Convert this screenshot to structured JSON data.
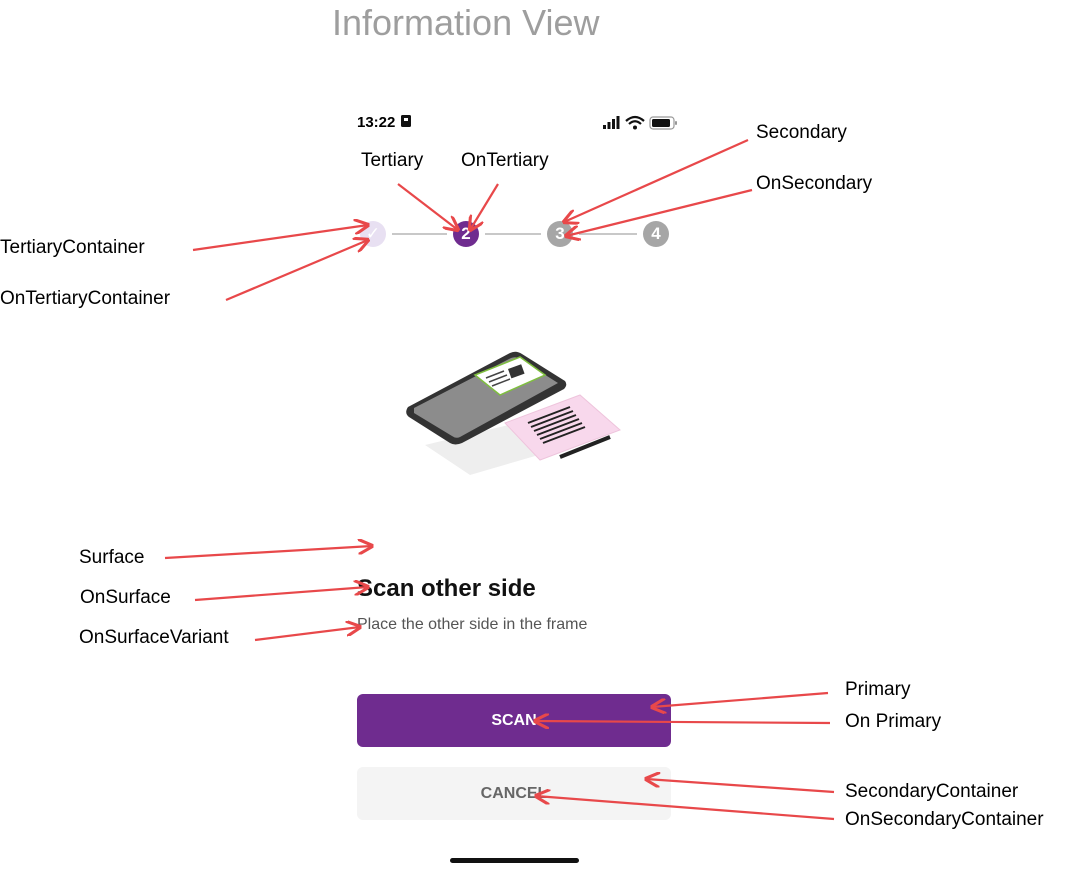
{
  "page": {
    "title": "Information View"
  },
  "status_bar": {
    "time": "13:22",
    "icons": [
      "sim-icon",
      "signal-icon",
      "wifi-icon",
      "battery-icon"
    ]
  },
  "stepper": {
    "steps": [
      {
        "label": "✓",
        "state": "completed"
      },
      {
        "label": "2",
        "state": "current"
      },
      {
        "label": "3",
        "state": "upcoming"
      },
      {
        "label": "4",
        "state": "upcoming"
      }
    ]
  },
  "content": {
    "heading": "Scan other side",
    "subtext": "Place the other side in the frame"
  },
  "actions": {
    "scan_label": "SCAN",
    "cancel_label": "CANCEL"
  },
  "annotations": {
    "tertiary": "Tertiary",
    "on_tertiary": "OnTertiary",
    "secondary": "Secondary",
    "on_secondary": "OnSecondary",
    "tertiary_container": "TertiaryContainer",
    "on_tertiary_container": "OnTertiaryContainer",
    "surface": "Surface",
    "on_surface": "OnSurface",
    "on_surface_variant": "OnSurfaceVariant",
    "primary": "Primary",
    "on_primary": "On Primary",
    "secondary_container": "SecondaryContainer",
    "on_secondary_container": "OnSecondaryContainer"
  },
  "colors": {
    "primary": "#6f2c8f",
    "tertiary_container": "#e8e0f2",
    "secondary": "#a6a6a6",
    "secondary_container": "#f4f4f4",
    "arrow": "#e8484a",
    "title_gray": "#9e9e9e"
  }
}
